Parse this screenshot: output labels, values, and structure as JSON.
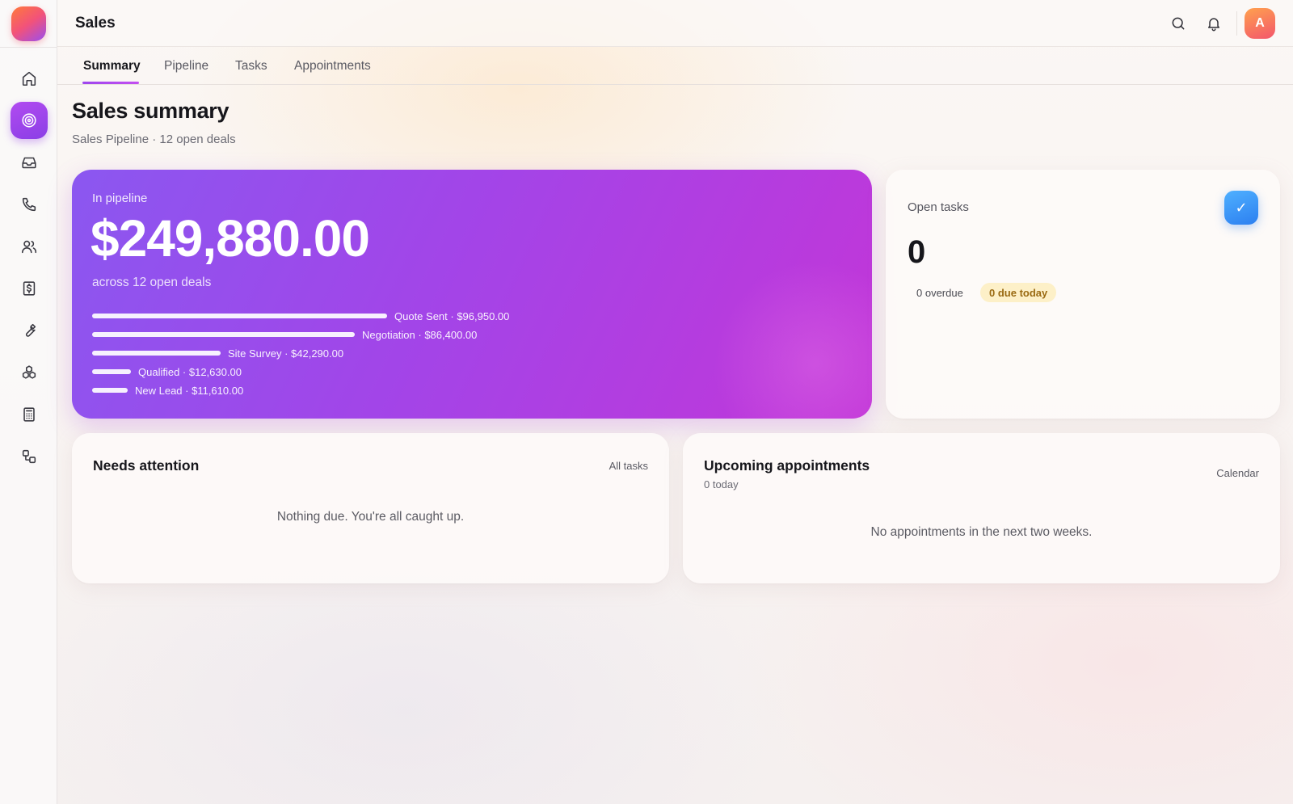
{
  "app": {
    "title": "Sales",
    "avatar_initial": "A"
  },
  "sidebar": {
    "items": [
      {
        "name": "home",
        "icon": "home-icon"
      },
      {
        "name": "sales",
        "icon": "target-icon",
        "active": true
      },
      {
        "name": "inbox",
        "icon": "inbox-icon"
      },
      {
        "name": "calls",
        "icon": "phone-icon"
      },
      {
        "name": "contacts",
        "icon": "users-icon"
      },
      {
        "name": "invoices",
        "icon": "dollar-receipt-icon"
      },
      {
        "name": "tools",
        "icon": "wrench-icon"
      },
      {
        "name": "products",
        "icon": "boxes-icon"
      },
      {
        "name": "calculator",
        "icon": "calculator-icon"
      },
      {
        "name": "workflows",
        "icon": "workflow-icon"
      }
    ]
  },
  "tabs": [
    {
      "label": "Summary",
      "active": true
    },
    {
      "label": "Pipeline"
    },
    {
      "label": "Tasks"
    },
    {
      "label": "Appointments"
    }
  ],
  "page": {
    "title": "Sales summary",
    "subtitle": "Sales Pipeline · 12 open deals"
  },
  "pipeline": {
    "label": "In pipeline",
    "amount": "$249,880.00",
    "subtext": "across 12 open deals",
    "stages": [
      {
        "name": "Quote Sent",
        "value": 96950,
        "text": "Quote Sent · $96,950.00"
      },
      {
        "name": "Negotiation",
        "value": 86400,
        "text": "Negotiation · $86,400.00"
      },
      {
        "name": "Site Survey",
        "value": 42290,
        "text": "Site Survey · $42,290.00"
      },
      {
        "name": "Qualified",
        "value": 12630,
        "text": "Qualified · $12,630.00"
      },
      {
        "name": "New Lead",
        "value": 11610,
        "text": "New Lead · $11,610.00"
      }
    ]
  },
  "open_tasks": {
    "label": "Open tasks",
    "count": "0",
    "overdue": "0 overdue",
    "due_today": "0 due today",
    "check_glyph": "✓"
  },
  "needs_attention": {
    "title": "Needs attention",
    "link": "All tasks",
    "empty": "Nothing due. You're all caught up."
  },
  "upcoming": {
    "title": "Upcoming appointments",
    "subtitle": "0 today",
    "link": "Calendar",
    "empty": "No appointments in the next two weeks."
  },
  "colors": {
    "accent": "#a245e8",
    "due_today_bg": "#fdf0c8",
    "due_today_text": "#9a6a12",
    "check_blue": "#2c7ff0"
  }
}
